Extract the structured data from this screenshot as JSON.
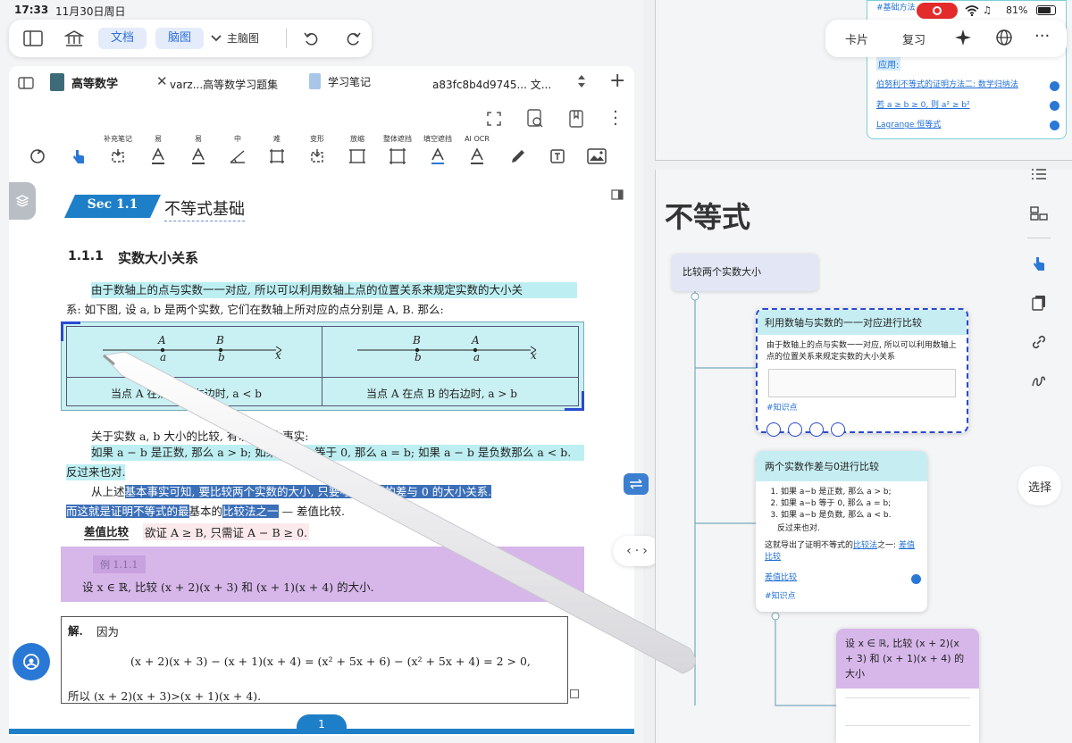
{
  "status_bar": {
    "time": "17:33",
    "date": "11月30日周日",
    "battery": "81%"
  },
  "top_toolbar": {
    "doc_label": "文档",
    "mindmap_label": "脑图",
    "main_mindmap_label": "主脑图"
  },
  "right_toolbar": {
    "cards_label": "卡片",
    "review_label": "复习"
  },
  "tabs": [
    {
      "label": "高等数学"
    },
    {
      "label": "varz...高等数学习题集"
    },
    {
      "label": "学习笔记"
    },
    {
      "label": "a83fc8b4d9745... 文..."
    }
  ],
  "tools": [
    {
      "label": "",
      "icon": "sync-icon"
    },
    {
      "label": "",
      "icon": "hand-pointer-icon"
    },
    {
      "label": "补充笔记",
      "icon": "note-icon"
    },
    {
      "label": "易",
      "icon": "text-a-icon"
    },
    {
      "label": "易",
      "icon": "text-a-icon"
    },
    {
      "label": "中",
      "icon": "geometry-icon"
    },
    {
      "label": "难",
      "icon": "frame-icon"
    },
    {
      "label": "变形",
      "icon": "transform-icon"
    },
    {
      "label": "放缩",
      "icon": "scale-icon"
    },
    {
      "label": "整体遮挡",
      "icon": "cover-icon"
    },
    {
      "label": "填空遮挡",
      "icon": "fill-cover-icon"
    },
    {
      "label": "AI OCR",
      "icon": "ocr-icon"
    },
    {
      "label": "",
      "icon": "pencil-icon"
    },
    {
      "label": "",
      "icon": "text-box-icon"
    },
    {
      "label": "",
      "icon": "image-icon"
    }
  ],
  "document": {
    "section_badge": "Sec 1.1",
    "section_title": "不等式基础",
    "subsection_number": "1.1.1",
    "subsection_title": "实数大小关系",
    "para1_line1": "由于数轴上的点与实数一一对应, 所以可以利用数轴上点的位置关系来规定实数的大小关",
    "para1_line2": "系: 如下图, 设 a, b 是两个实数, 它们在数轴上所对应的点分别是 A, B. 那么:",
    "figure": {
      "left": {
        "A": "A",
        "B": "B",
        "a": "a",
        "b": "b",
        "x": "x",
        "caption": "当点 A 在点 B 的左边时, a < b"
      },
      "right": {
        "A": "A",
        "B": "B",
        "a": "a",
        "b": "b",
        "x": "x",
        "caption": "当点 A 在点 B 的右边时, a > b"
      }
    },
    "para2": "关于实数 a, b 大小的比较, 有以下基本事实:",
    "para3": "如果 a − b 是正数, 那么 a > b; 如果 a − b 等于 0, 那么 a = b; 如果 a − b 是负数那么 a < b.",
    "para3b": "反过来也对.",
    "para4a": "从上述",
    "para4b": "基本事实可知, 要比较两个实数的大小, 只要考察它们的差与 0 的大小关系.",
    "para4c": "而这就是证明不等式的最",
    "para4d": "基本的",
    "para4e": "比较法之一",
    "para4f": "差值比较.",
    "diff_label": "差值比较",
    "diff_text": "欲证 A ≥ B, 只需证 A − B ≥ 0.",
    "example_label": "例 1.1.1",
    "example_text": "设 x ∈ ℝ, 比较 (x + 2)(x + 3) 和 (x + 1)(x + 4) 的大小.",
    "solution_label": "解.",
    "solution_intro": "因为",
    "solution_eq": "(x + 2)(x + 3) − (x + 1)(x + 4) = (x² + 5x + 6) − (x² + 5x + 4) = 2 > 0,",
    "solution_conclusion": "所以 (x + 2)(x + 3)>(x + 1)(x + 4).",
    "page_number": "1"
  },
  "top_card": {
    "item0": "#基础方法",
    "item1": "应用:",
    "item2": "伯努利不等式的证明方法二: 数学归纳法",
    "item3": "若 a ≥ b ≥ 0, 则 a² ≥ b²",
    "item4": "Lagrange 恒等式"
  },
  "mindmap": {
    "root_title": "不等式",
    "node1": "比较两个实数大小",
    "card1": {
      "title": "利用数轴与实数的一一对应进行比较",
      "body": "由于数轴上的点与实数一一对应, 所以可以利用数轴上点的位置关系来规定实数的大小关系",
      "tag": "#知识点"
    },
    "card2": {
      "title": "两个实数作差与0进行比较",
      "items": [
        "如果 a−b 是正数, 那么 a > b;",
        "如果 a−b 等于 0, 那么 a = b;",
        "如果 a−b 是负数, 那么 a < b."
      ],
      "extra": "反过来也对.",
      "text1": "这就导出了证明不等式的",
      "link1": "比较法",
      "text2": "之一:",
      "link2": "差值比较",
      "link3": "差值比较",
      "tag": "#知识点"
    },
    "card3": {
      "title": "设 x ∈ ℝ, 比较 (x + 2)(x + 3) 和 (x + 1)(x + 4) 的大小"
    }
  },
  "right_sidebar": {
    "select_label": "选择"
  },
  "colors": {
    "accent": "#1f6fd6",
    "highlight_cyan": "#bdeff2",
    "highlight_blue": "#3b6fb8",
    "example_purple": "#d7b7ea",
    "badge_blue": "#1e7fc9"
  }
}
